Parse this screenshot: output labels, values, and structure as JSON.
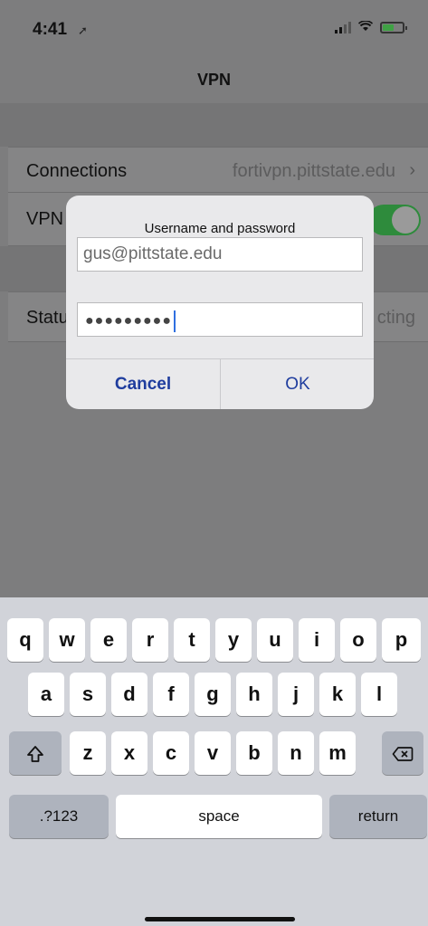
{
  "status_bar": {
    "time": "4:41",
    "location_icon": "location-arrow-icon",
    "signal_icon": "cellular-signal-icon",
    "wifi_icon": "wifi-icon",
    "battery_icon": "battery-charging-icon",
    "battery_color": "#3fa244"
  },
  "nav": {
    "title": "VPN"
  },
  "rows": {
    "connections": {
      "label": "Connections",
      "value": "fortivpn.pittstate.edu"
    },
    "vpn": {
      "label": "VPN",
      "toggle_on": true,
      "toggle_color": "#2e8b3c"
    },
    "status": {
      "label": "Statu",
      "value": "cting"
    }
  },
  "dialog": {
    "title": "Username and password",
    "username_value": "gus@pittstate.edu",
    "password_mask": "●●●●●●●●●",
    "cancel_label": "Cancel",
    "ok_label": "OK",
    "button_color": "#1f3d9e"
  },
  "keyboard": {
    "row1": [
      "q",
      "w",
      "e",
      "r",
      "t",
      "y",
      "u",
      "i",
      "o",
      "p"
    ],
    "row2": [
      "a",
      "s",
      "d",
      "f",
      "g",
      "h",
      "j",
      "k",
      "l"
    ],
    "row3": [
      "z",
      "x",
      "c",
      "v",
      "b",
      "n",
      "m"
    ],
    "shift_icon": "shift-icon",
    "delete_icon": "delete-backspace-icon",
    "numbers_label": ".?123",
    "space_label": "space",
    "return_label": "return"
  }
}
